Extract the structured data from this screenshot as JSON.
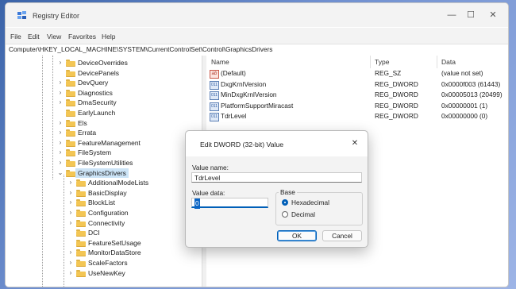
{
  "window": {
    "title": "Registry Editor",
    "controls": {
      "minimize": "—",
      "maximize": "☐",
      "close": "✕"
    }
  },
  "menu": [
    "File",
    "Edit",
    "View",
    "Favorites",
    "Help"
  ],
  "address": "Computer\\HKEY_LOCAL_MACHINE\\SYSTEM\\CurrentControlSet\\Control\\GraphicsDrivers",
  "tree": [
    {
      "label": "DeviceOverrides",
      "expandable": true,
      "level": 1,
      "selected": false
    },
    {
      "label": "DevicePanels",
      "expandable": false,
      "level": 1,
      "selected": false
    },
    {
      "label": "DevQuery",
      "expandable": true,
      "level": 1,
      "selected": false
    },
    {
      "label": "Diagnostics",
      "expandable": true,
      "level": 1,
      "selected": false
    },
    {
      "label": "DmaSecurity",
      "expandable": true,
      "level": 1,
      "selected": false
    },
    {
      "label": "EarlyLaunch",
      "expandable": false,
      "level": 1,
      "selected": false
    },
    {
      "label": "Els",
      "expandable": true,
      "level": 1,
      "selected": false
    },
    {
      "label": "Errata",
      "expandable": true,
      "level": 1,
      "selected": false
    },
    {
      "label": "FeatureManagement",
      "expandable": true,
      "level": 1,
      "selected": false
    },
    {
      "label": "FileSystem",
      "expandable": true,
      "level": 1,
      "selected": false
    },
    {
      "label": "FileSystemUtilities",
      "expandable": true,
      "level": 1,
      "selected": false
    },
    {
      "label": "GraphicsDrivers",
      "expandable": true,
      "expanded": true,
      "level": 1,
      "selected": true
    },
    {
      "label": "AdditionalModeLists",
      "expandable": true,
      "level": 2,
      "selected": false
    },
    {
      "label": "BasicDisplay",
      "expandable": true,
      "level": 2,
      "selected": false
    },
    {
      "label": "BlockList",
      "expandable": true,
      "level": 2,
      "selected": false
    },
    {
      "label": "Configuration",
      "expandable": true,
      "level": 2,
      "selected": false
    },
    {
      "label": "Connectivity",
      "expandable": true,
      "level": 2,
      "selected": false
    },
    {
      "label": "DCI",
      "expandable": false,
      "level": 2,
      "selected": false
    },
    {
      "label": "FeatureSetUsage",
      "expandable": false,
      "level": 2,
      "selected": false
    },
    {
      "label": "MonitorDataStore",
      "expandable": true,
      "level": 2,
      "selected": false
    },
    {
      "label": "ScaleFactors",
      "expandable": true,
      "level": 2,
      "selected": false
    },
    {
      "label": "UseNewKey",
      "expandable": true,
      "level": 2,
      "selected": false
    }
  ],
  "list": {
    "headers": {
      "name": "Name",
      "type": "Type",
      "data": "Data"
    },
    "rows": [
      {
        "name": "(Default)",
        "type": "REG_SZ",
        "data": "(value not set)",
        "icon": "string-value-icon",
        "glyph": "ab"
      },
      {
        "name": "DxgKrnlVersion",
        "type": "REG_DWORD",
        "data": "0x0000f003 (61443)",
        "icon": "binary-value-icon",
        "glyph": "011"
      },
      {
        "name": "MinDxgKrnlVersion",
        "type": "REG_DWORD",
        "data": "0x00005013 (20499)",
        "icon": "binary-value-icon",
        "glyph": "011"
      },
      {
        "name": "PlatformSupportMiracast",
        "type": "REG_DWORD",
        "data": "0x00000001 (1)",
        "icon": "binary-value-icon",
        "glyph": "011"
      },
      {
        "name": "TdrLevel",
        "type": "REG_DWORD",
        "data": "0x00000000 (0)",
        "icon": "binary-value-icon",
        "glyph": "011"
      }
    ]
  },
  "dialog": {
    "title": "Edit DWORD (32-bit) Value",
    "close": "✕",
    "value_name_label": "Value name:",
    "value_name": "TdrLevel",
    "value_data_label": "Value data:",
    "value_data": "0",
    "base_label": "Base",
    "hex_label": "Hexadecimal",
    "dec_label": "Decimal",
    "ok_label": "OK",
    "cancel_label": "Cancel"
  },
  "colors": {
    "accent": "#005fb8",
    "selection": "#cce4f7",
    "folder": "#f3c654"
  }
}
